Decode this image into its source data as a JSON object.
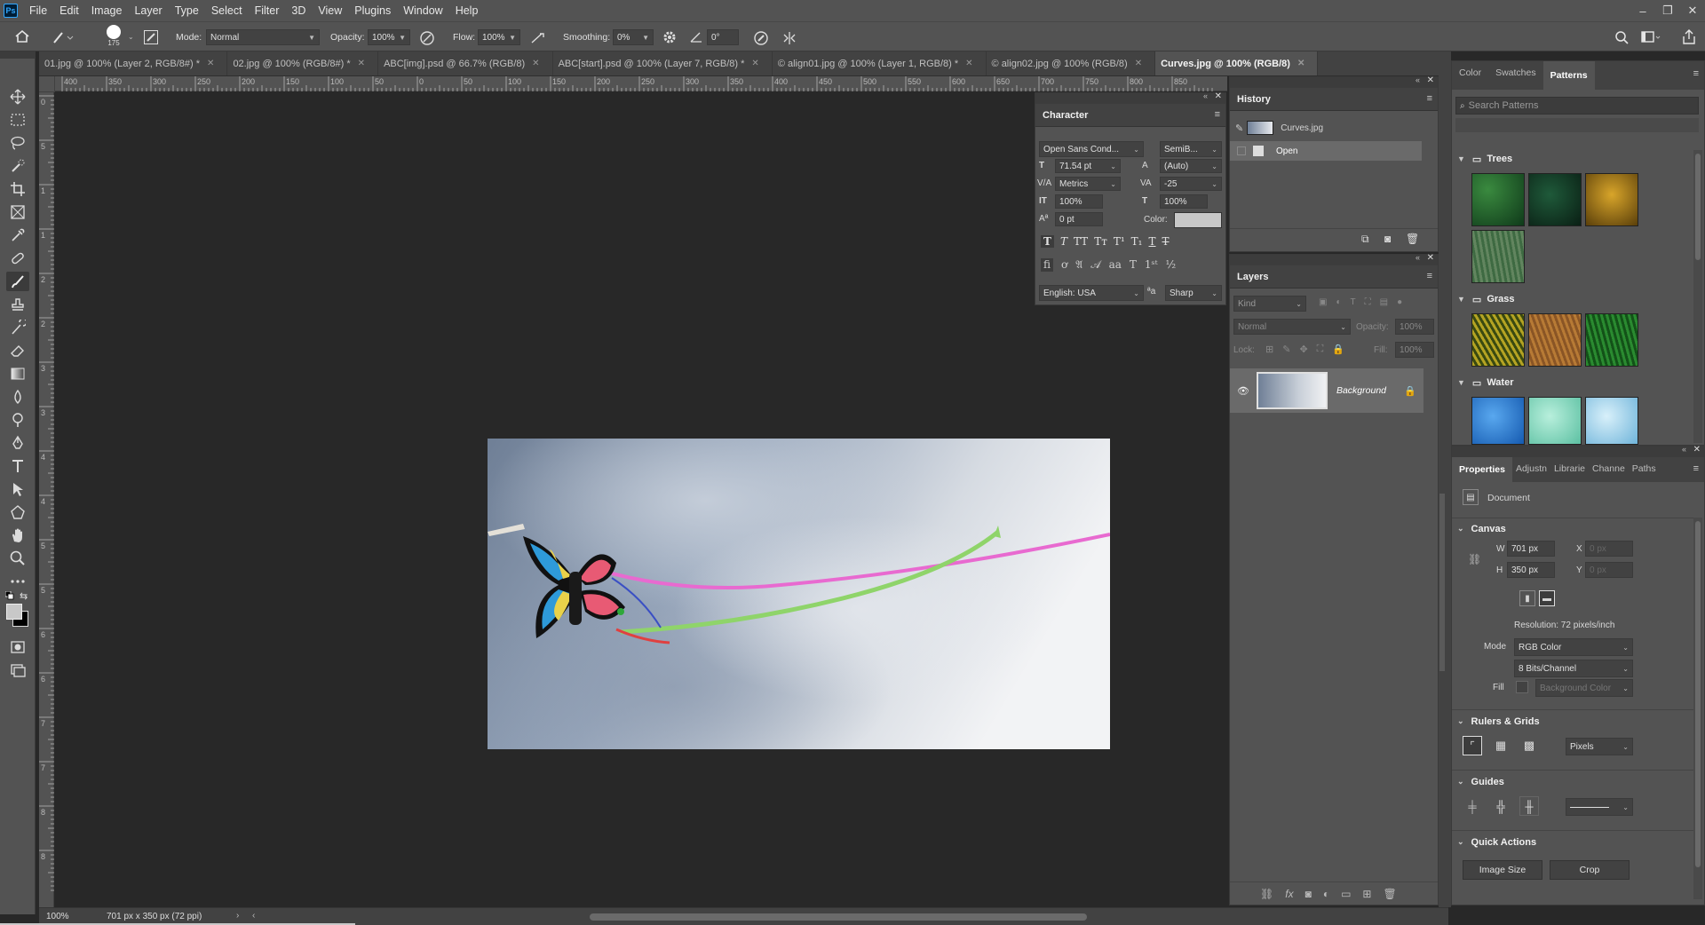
{
  "app": {
    "logo": "Ps"
  },
  "menu": [
    "File",
    "Edit",
    "Image",
    "Layer",
    "Type",
    "Select",
    "Filter",
    "3D",
    "View",
    "Plugins",
    "Window",
    "Help"
  ],
  "options_bar": {
    "brush_size": "175",
    "mode_label": "Mode:",
    "mode_value": "Normal",
    "opacity_label": "Opacity:",
    "opacity_value": "100%",
    "flow_label": "Flow:",
    "flow_value": "100%",
    "smoothing_label": "Smoothing:",
    "smoothing_value": "0%",
    "angle_value": "0°"
  },
  "tabs": [
    {
      "label": "01.jpg @ 100% (Layer 2, RGB/8#) *",
      "active": false
    },
    {
      "label": "02.jpg @ 100% (RGB/8#) *",
      "active": false
    },
    {
      "label": "ABC[img].psd @ 66.7% (RGB/8)",
      "active": false
    },
    {
      "label": "ABC[start].psd @ 100% (Layer 7, RGB/8) *",
      "active": false
    },
    {
      "label": "© align01.jpg @ 100% (Layer 1, RGB/8) *",
      "active": false
    },
    {
      "label": "© align02.jpg @ 100% (RGB/8)",
      "active": false
    },
    {
      "label": "Curves.jpg @ 100% (RGB/8)",
      "active": true
    }
  ],
  "ruler_h": [
    "400",
    "350",
    "300",
    "250",
    "200",
    "150",
    "100",
    "50",
    "0",
    "50",
    "100",
    "150",
    "200",
    "250",
    "300",
    "350",
    "400",
    "450",
    "500",
    "550",
    "600",
    "650",
    "700",
    "750",
    "800",
    "850"
  ],
  "ruler_v": [
    "0",
    "5",
    "1",
    "1",
    "2",
    "2",
    "3",
    "3",
    "4",
    "4",
    "5",
    "5",
    "6",
    "6",
    "7",
    "7",
    "8",
    "8"
  ],
  "status": {
    "zoom": "100%",
    "doc_info": "701 px x 350 px (72 ppi)"
  },
  "character": {
    "title": "Character",
    "font_family": "Open Sans Cond...",
    "font_style": "SemiB...",
    "size": "71.54 pt",
    "leading": "(Auto)",
    "kerning": "Metrics",
    "tracking": "-25",
    "vscale": "100%",
    "hscale": "100%",
    "baseline": "0 pt",
    "color_label": "Color:",
    "language": "English: USA",
    "aa": "Sharp"
  },
  "history": {
    "title": "History",
    "snapshot": "Curves.jpg",
    "items": [
      "Open"
    ]
  },
  "layers": {
    "title": "Layers",
    "kind_placeholder": "Kind",
    "blend": "Normal",
    "opacity_label": "Opacity:",
    "opacity_value": "100%",
    "lock_label": "Lock:",
    "fill_label": "Fill:",
    "fill_value": "100%",
    "items": [
      {
        "name": "Background",
        "locked": true,
        "visible": true
      }
    ]
  },
  "patterns_panel": {
    "tabs": [
      "Color",
      "Swatches",
      "Patterns"
    ],
    "active_tab": "Patterns",
    "search_placeholder": "Search Patterns",
    "groups": [
      {
        "name": "Trees",
        "colors": [
          "#1f5a2a",
          "#163a2a",
          "#b08a1a",
          "#4b6a48"
        ]
      },
      {
        "name": "Grass",
        "colors": [
          "#8a7d1e",
          "#9a6a2a",
          "#1f6a25"
        ]
      },
      {
        "name": "Water",
        "colors": [
          "#2a7ad0",
          "#7fd0b8",
          "#8cc8e8"
        ]
      }
    ]
  },
  "properties": {
    "tabs": [
      "Properties",
      "Adjustn",
      "Librarie",
      "Channe",
      "Paths"
    ],
    "active_tab": "Properties",
    "doc_label": "Document",
    "canvas_title": "Canvas",
    "w_label": "W",
    "w_value": "701 px",
    "h_label": "H",
    "h_value": "350 px",
    "x_label": "X",
    "x_value": "0 px",
    "y_label": "Y",
    "y_value": "0 px",
    "resolution": "Resolution: 72 pixels/inch",
    "mode_label": "Mode",
    "mode_value": "RGB Color",
    "depth_value": "8 Bits/Channel",
    "fill_label": "Fill",
    "fill_value": "Background Color",
    "rulers_title": "Rulers & Grids",
    "units": "Pixels",
    "guides_title": "Guides",
    "quick_title": "Quick Actions",
    "image_size_btn": "Image Size",
    "crop_btn": "Crop"
  },
  "colors": {
    "panel": "#535353",
    "dark": "#424242",
    "canvas_bg": "#282828",
    "accent": "#31a8ff"
  }
}
